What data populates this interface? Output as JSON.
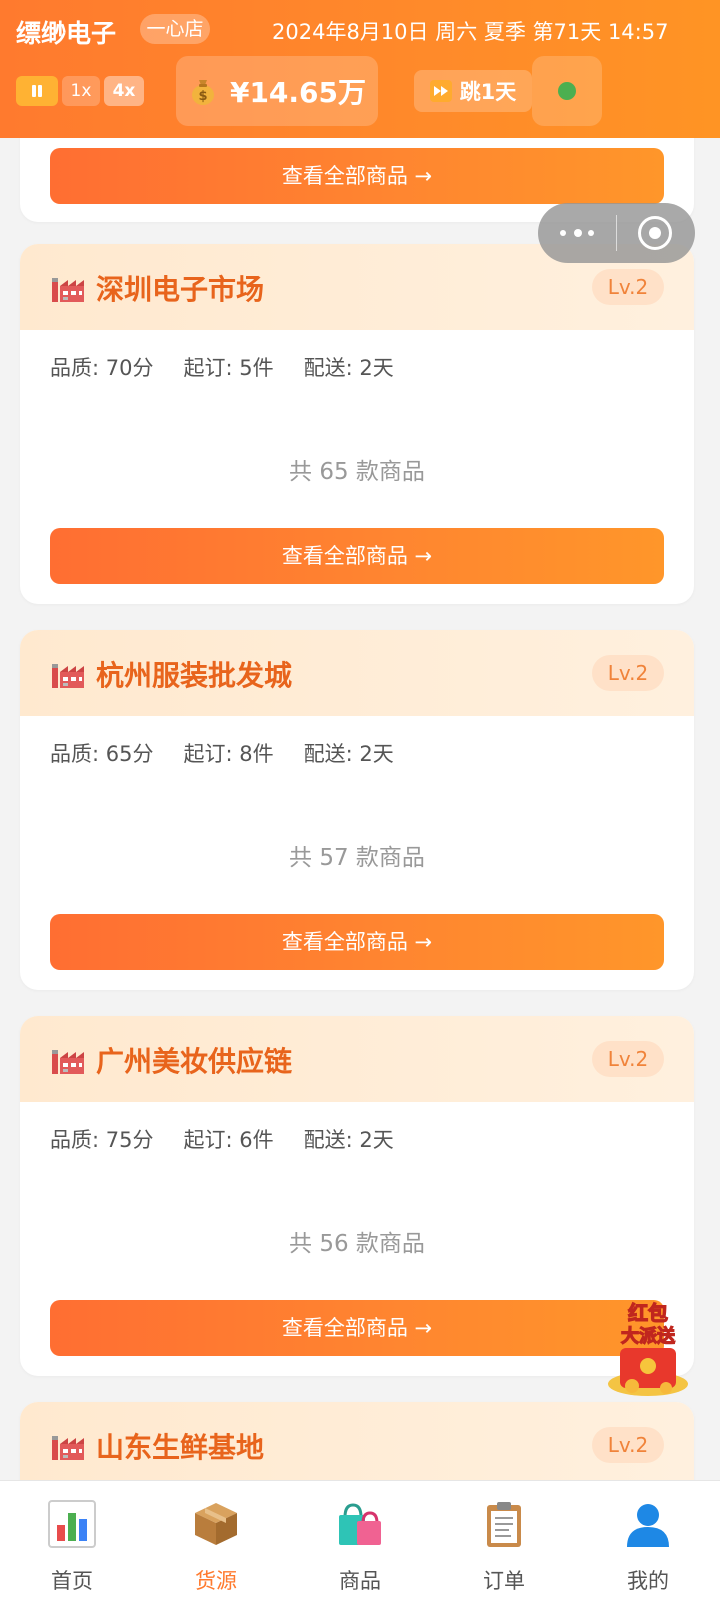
{
  "header": {
    "shop_name": "缥缈电子",
    "shop_badge": "一心店",
    "datetime": "2024年8月10日 周六 夏季 第71天 14:57",
    "speed_options": [
      "1x",
      "4x"
    ],
    "selected_speed": "4x",
    "money": "¥14.65万",
    "skip_label": "跳1天",
    "status_color": "#4caf50"
  },
  "partial_card": {
    "view_button": "查看全部商品 →"
  },
  "suppliers": [
    {
      "name": "深圳电子市场",
      "level": "Lv.2",
      "quality": "品质: 70分",
      "min_order": "起订: 5件",
      "delivery": "配送: 2天",
      "count": "共 65 款商品",
      "view_button": "查看全部商品 →"
    },
    {
      "name": "杭州服装批发城",
      "level": "Lv.2",
      "quality": "品质: 65分",
      "min_order": "起订: 8件",
      "delivery": "配送: 2天",
      "count": "共 57 款商品",
      "view_button": "查看全部商品 →"
    },
    {
      "name": "广州美妆供应链",
      "level": "Lv.2",
      "quality": "品质: 75分",
      "min_order": "起订: 6件",
      "delivery": "配送: 2天",
      "count": "共 56 款商品",
      "view_button": "查看全部商品 →"
    },
    {
      "name": "山东生鲜基地",
      "level": "Lv.2"
    }
  ],
  "promo": {
    "line1": "红包",
    "line2": "大派送"
  },
  "tabs": [
    {
      "label": "首页",
      "icon": "bar-chart-icon"
    },
    {
      "label": "货源",
      "icon": "package-icon"
    },
    {
      "label": "商品",
      "icon": "shopping-bags-icon"
    },
    {
      "label": "订单",
      "icon": "clipboard-icon"
    },
    {
      "label": "我的",
      "icon": "user-icon"
    }
  ],
  "active_tab": "货源",
  "colors": {
    "accent": "#ff7a2e",
    "supplier_title": "#e8641c",
    "header_gradient_start": "#ff7a2e",
    "header_gradient_end": "#ff9424"
  }
}
